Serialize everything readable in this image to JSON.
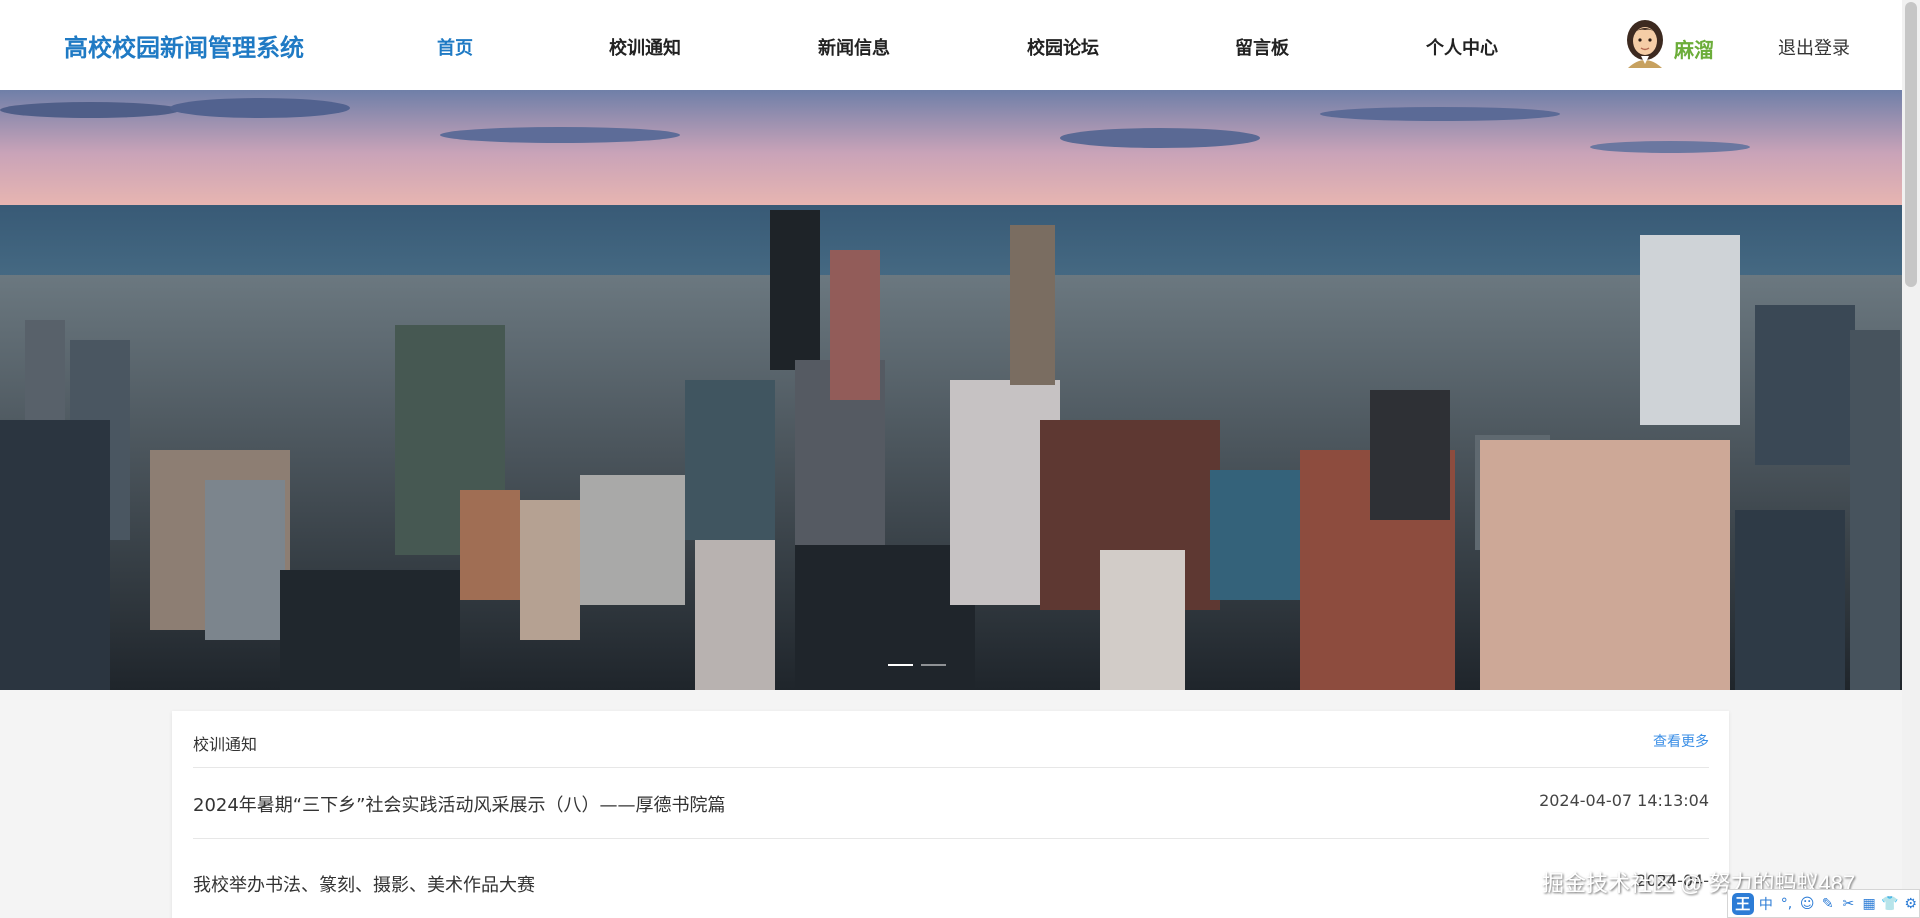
{
  "header": {
    "brand": "高校校园新闻管理系统",
    "nav": [
      {
        "label": "首页",
        "active": true
      },
      {
        "label": "校训通知",
        "active": false
      },
      {
        "label": "新闻信息",
        "active": false
      },
      {
        "label": "校园论坛",
        "active": false
      },
      {
        "label": "留言板",
        "active": false
      },
      {
        "label": "个人中心",
        "active": false
      }
    ],
    "username": "麻溜",
    "logout": "退出登录"
  },
  "banner": {
    "image": "city-skyline-aerial",
    "carousel_indicators": 2,
    "active_indicator": 0
  },
  "notice_section": {
    "title": "校训通知",
    "more_label": "查看更多",
    "items": [
      {
        "title": "2024年暑期“三下乡”社会实践活动风采展示（八）——厚德书院篇",
        "date": "2024-04-07 14:13:04"
      },
      {
        "title": "我校举办书法、篆刻、摄影、美术作品大赛",
        "date": "2024-04-"
      }
    ]
  },
  "watermark": "掘金技术社区 @ 努力的蚂蚁487",
  "ime_toolbar": {
    "logo": "王",
    "buttons": [
      "中",
      "°,",
      "☺",
      "✎",
      "✂",
      "▦",
      "👕",
      "⚙"
    ]
  },
  "colors": {
    "brand": "#1f7ac4",
    "active_nav": "#1f7ac4",
    "username": "#6cad3a",
    "more_link": "#3a8ee6"
  }
}
